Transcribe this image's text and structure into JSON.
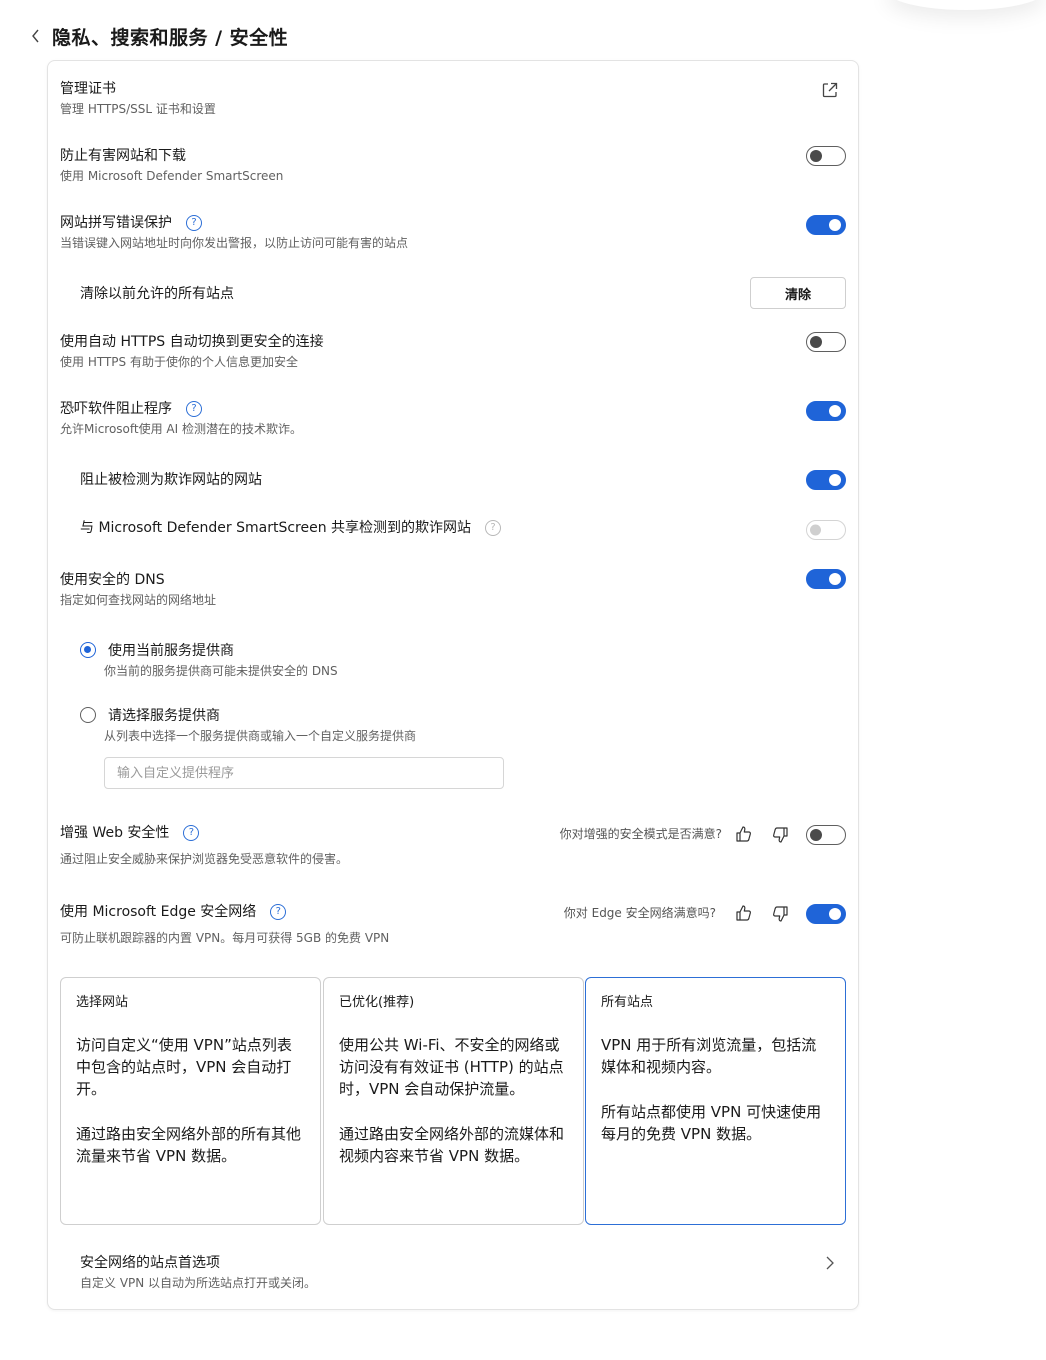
{
  "header": {
    "back_icon": "chevron-left-icon",
    "title": "隐私、搜索和服务 / 安全性"
  },
  "settings": {
    "manage_certs": {
      "title": "管理证书",
      "desc": "管理 HTTPS/SSL 证书和设置",
      "icon": "external-link-icon"
    },
    "smartscreen": {
      "title": "防止有害网站和下载",
      "desc": "使用 Microsoft Defender SmartScreen",
      "state": "off"
    },
    "typo_protection": {
      "title": "网站拼写错误保护",
      "desc": "当错误键入网站地址时向你发出警报，以防止访问可能有害的站点",
      "state": "on"
    },
    "clear_allowed": {
      "title": "清除以前允许的所有站点",
      "button": "清除"
    },
    "auto_https": {
      "title": "使用自动 HTTPS 自动切换到更安全的连接",
      "desc": "使用 HTTPS 有助于使你的个人信息更加安全",
      "state": "off"
    },
    "scareware": {
      "title": "恐吓软件阻止程序",
      "desc": "允许Microsoft使用 AI 检测潜在的技术欺诈。",
      "state": "on"
    },
    "block_scam": {
      "title": "阻止被检测为欺诈网站的网站",
      "state": "on"
    },
    "share_scam": {
      "title": "与 Microsoft Defender SmartScreen 共享检测到的欺诈网站",
      "state": "disabled"
    },
    "secure_dns": {
      "title": "使用安全的 DNS",
      "desc": "指定如何查找网站的网络地址",
      "state": "on"
    },
    "dns_current": {
      "title": "使用当前服务提供商",
      "desc": "你当前的服务提供商可能未提供安全的 DNS",
      "checked": true
    },
    "dns_choose": {
      "title": "请选择服务提供商",
      "desc": "从列表中选择一个服务提供商或输入一个自定义服务提供商",
      "checked": false,
      "input_placeholder": "输入自定义提供程序",
      "input_value": ""
    },
    "web_security": {
      "title": "增强 Web 安全性",
      "desc": "通过阻止安全威胁来保护浏览器免受恶意软件的侵害。",
      "feedback": "你对增强的安全模式是否满意?",
      "state": "off"
    },
    "secure_network": {
      "title": "使用 Microsoft Edge 安全网络",
      "desc": "可防止联机跟踪器的内置 VPN。每月可获得 5GB 的免费 VPN",
      "feedback": "你对 Edge 安全网络满意吗?",
      "state": "on"
    }
  },
  "vpn_options": [
    {
      "title": "选择网站",
      "body": "访问自定义“使用 VPN”站点列表中包含的站点时，VPN 会自动打开。",
      "body2": "通过路由安全网络外部的所有其他流量来节省 VPN 数据。",
      "selected": false
    },
    {
      "title": "已优化(推荐)",
      "body": "使用公共 Wi-Fi、不安全的网络或访问没有有效证书 (HTTP) 的站点时，VPN 会自动保护流量。",
      "body2": "通过路由安全网络外部的流媒体和视频内容来节省 VPN 数据。",
      "selected": false
    },
    {
      "title": "所有站点",
      "body": "VPN 用于所有浏览流量，包括流媒体和视频内容。",
      "body2": "所有站点都使用 VPN 可快速使用每月的免费 VPN 数据。",
      "selected": true
    }
  ],
  "site_prefs": {
    "title": "安全网络的站点首选项",
    "desc": "自定义 VPN 以自动为所选站点打开或关闭。",
    "icon": "chevron-right-icon"
  },
  "colors": {
    "accent": "#1f64d8",
    "toggle_off_border": "#5f5f5f",
    "text_secondary": "#616161"
  },
  "icons": {
    "help": "question-circle-icon",
    "like": "thumbs-up-icon",
    "dislike": "thumbs-down-icon"
  }
}
